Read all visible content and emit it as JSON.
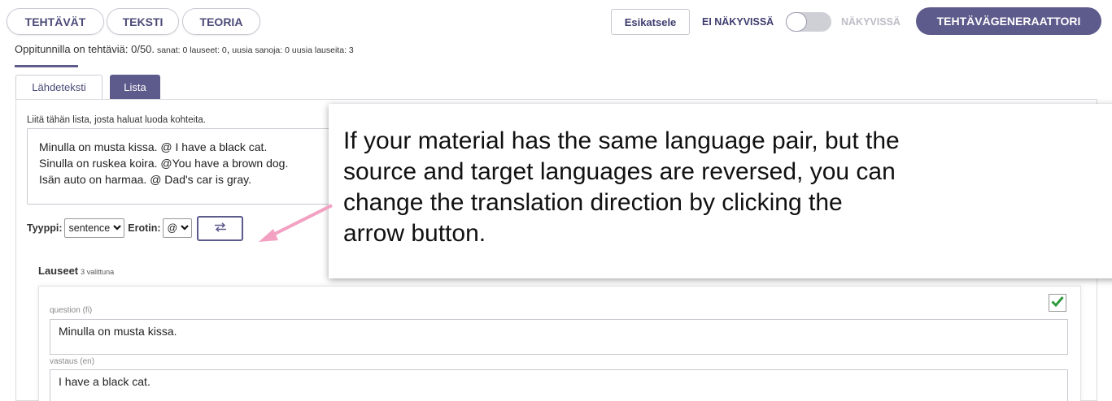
{
  "top_tabs": [
    "TEHTÄVÄT",
    "TEKSTI",
    "TEORIA"
  ],
  "preview_label": "Esikatsele",
  "visibility": {
    "off_label": "EI NÄKYVISSÄ",
    "on_label": "NÄKYVISSÄ",
    "is_visible": false
  },
  "generator_label": "TEHTÄVÄGENERAATTORI",
  "counts": {
    "main_prefix": "Oppitunnilla on tehtäviä: ",
    "main_value": "0/50.",
    "rest_a": " sanat: 0 lauseet: 0",
    "rest_b": ",",
    "rest_c": " uusia sanoja: 0 uusia lauseita: 3"
  },
  "subtabs": {
    "source": "Lähdeteksti",
    "list": "Lista",
    "active": "list"
  },
  "paste_label": "Liitä tähän lista, josta haluat luoda kohteita.",
  "source_lines": [
    "Minulla on musta kissa. @ I have a black cat.",
    "Sinulla on ruskea koira. @You have a brown dog.",
    "Isän auto on harmaa. @ Dad's car is gray."
  ],
  "controls": {
    "type_label": "Tyyppi:",
    "type_value": "sentence",
    "separator_label": "Erotin:",
    "separator_value": "@"
  },
  "sentences": {
    "title": "Lauseet",
    "selected_text": "3 valittuna",
    "item": {
      "checked": true,
      "question_label": "question (fi)",
      "question_value": "Minulla on musta kissa.",
      "answer_label": "vastaus (en)",
      "answer_value": "I have a black cat."
    }
  },
  "tooltip_lines": [
    "If your material has the same language pair, but the",
    "source and target languages are reversed, you can",
    "change the translation direction by clicking the",
    "arrow button."
  ],
  "colors": {
    "accent": "#5d5a8c",
    "tooltip_arrow": "#f2a1c2",
    "check": "#2e9a3e"
  },
  "icons": {
    "swap": "swap-arrows-icon",
    "check": "checkmark-icon",
    "chevron": "chevron-down-icon"
  }
}
